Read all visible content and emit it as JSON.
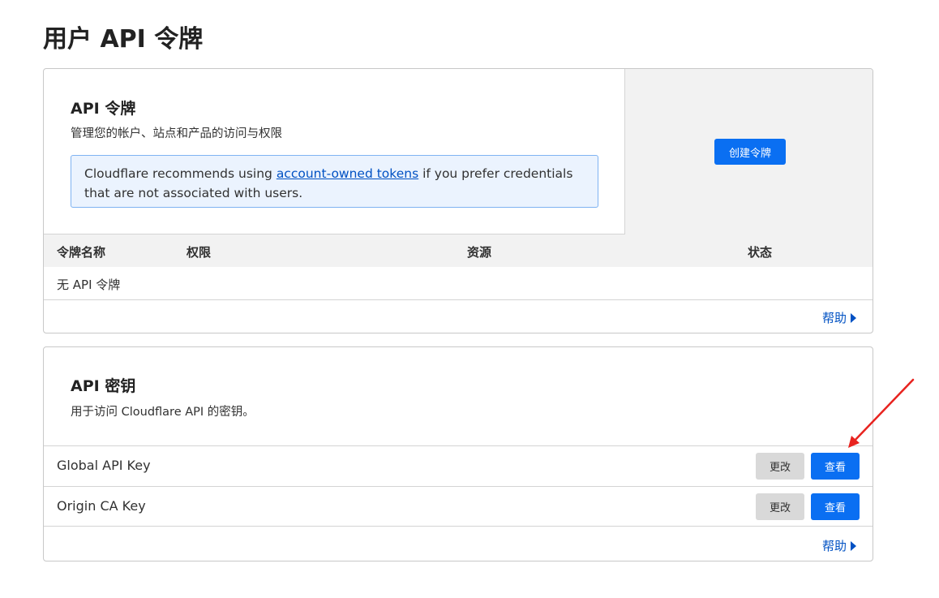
{
  "page": {
    "title": "用户 API 令牌"
  },
  "tokens": {
    "title": "API 令牌",
    "description": "管理您的帐户、站点和产品的访问与权限",
    "notice": {
      "before": "Cloudflare recommends using ",
      "link": "account-owned tokens",
      "after": " if you prefer credentials that are not associated with users."
    },
    "create_button": "创建令牌",
    "columns": [
      "令牌名称",
      "权限",
      "资源",
      "状态"
    ],
    "empty_text": "无 API 令牌",
    "help": "帮助"
  },
  "keys": {
    "title": "API 密钥",
    "description": "用于访问 Cloudflare API 的密钥。",
    "rows": [
      {
        "name": "Global API Key",
        "edit_label": "更改",
        "view_label": "查看"
      },
      {
        "name": "Origin CA Key",
        "edit_label": "更改",
        "view_label": "查看"
      }
    ],
    "help": "帮助"
  },
  "colors": {
    "primary": "#0a6ff2",
    "link": "#0051c3",
    "notice_bg": "#ebf3fe",
    "annotation": "#e8231f"
  },
  "icons": {
    "help_arrow": "caret-right-icon",
    "annotation": "red-arrow-icon"
  }
}
